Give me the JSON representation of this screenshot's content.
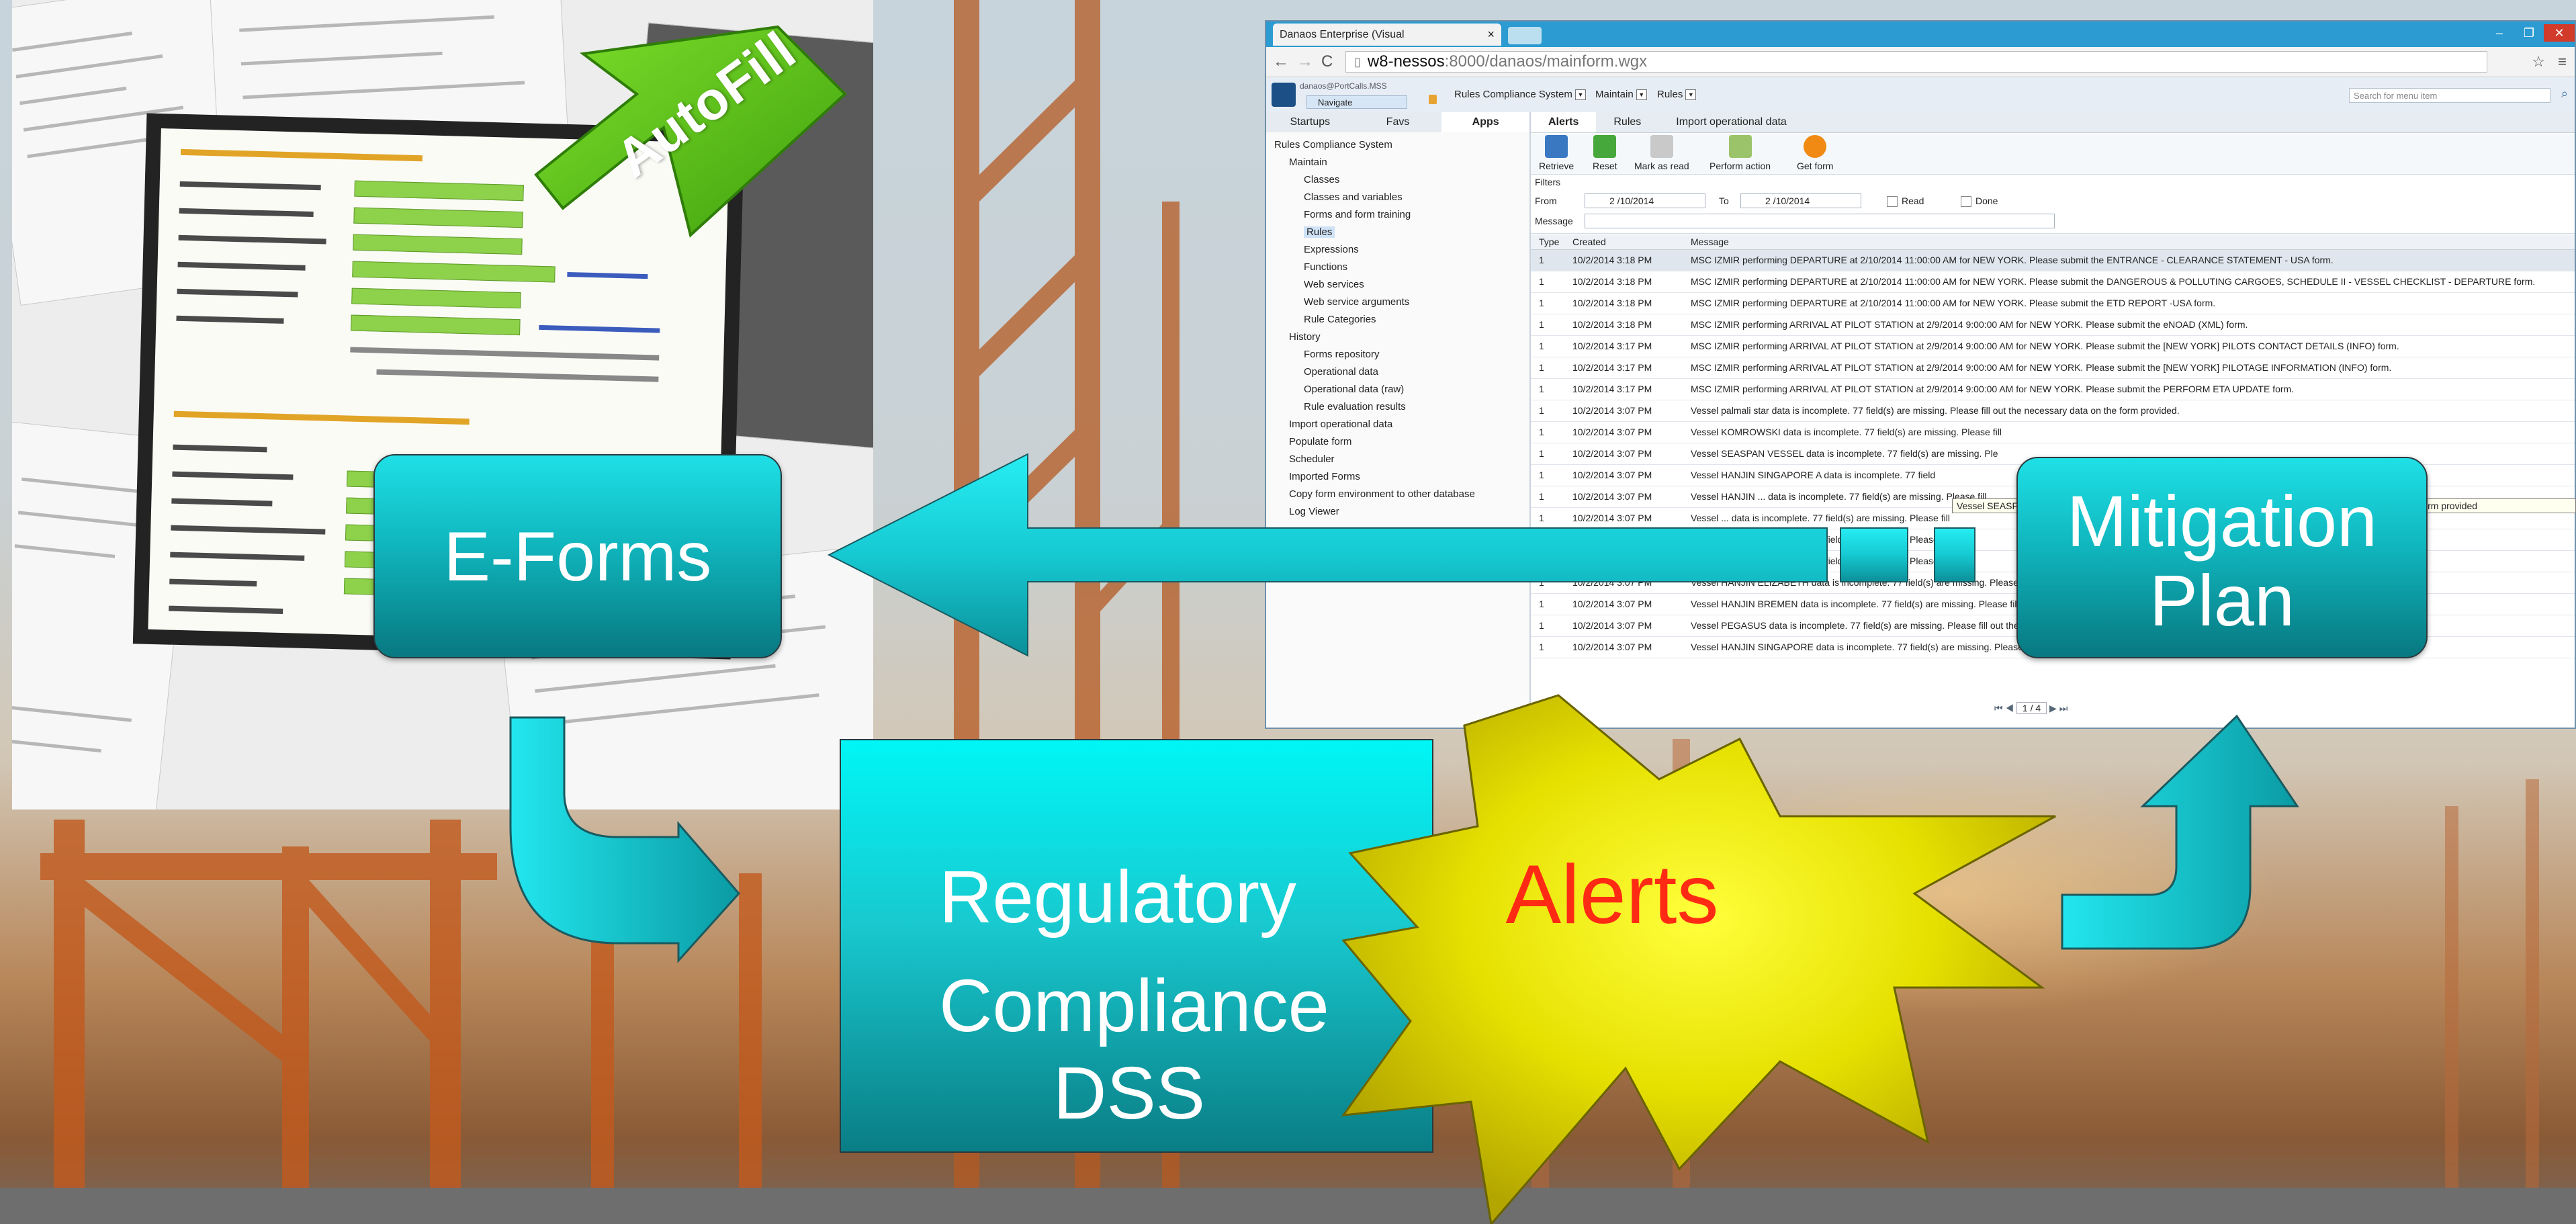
{
  "colors": {
    "box_cyan": "#12c3c9",
    "arrow_cyan": "#18d6e0",
    "alerts_yellow": "#f4f000",
    "alerts_text": "#ff2a14",
    "autofill_green": "#5ecb17"
  },
  "collage": {
    "autofill_label": "AutoFill"
  },
  "browser": {
    "tab_title": "Danaos Enterprise (Visual",
    "url_host": "w8-nessos",
    "url_path": ":8000/danaos/mainform.wgx",
    "user": "danaos@PortCalls.MSS",
    "navigate": "Navigate",
    "breadcrumbs": [
      "Rules Compliance System",
      "Maintain",
      "Rules"
    ],
    "search_placeholder": "Search for menu item",
    "side_tabs": [
      "Startups",
      "Favs",
      "Apps"
    ],
    "tree": [
      {
        "label": "Rules Compliance System",
        "level": 0
      },
      {
        "label": "Maintain",
        "level": 1
      },
      {
        "label": "Classes",
        "level": 2
      },
      {
        "label": "Classes and variables",
        "level": 2
      },
      {
        "label": "Forms and form training",
        "level": 2
      },
      {
        "label": "Rules",
        "level": 2
      },
      {
        "label": "Expressions",
        "level": 2
      },
      {
        "label": "Functions",
        "level": 2
      },
      {
        "label": "Web services",
        "level": 2
      },
      {
        "label": "Web service arguments",
        "level": 2
      },
      {
        "label": "Rule Categories",
        "level": 2
      },
      {
        "label": "History",
        "level": 1
      },
      {
        "label": "Forms repository",
        "level": 2
      },
      {
        "label": "Operational data",
        "level": 2
      },
      {
        "label": "Operational data (raw)",
        "level": 2
      },
      {
        "label": "Rule evaluation results",
        "level": 2
      },
      {
        "label": "Import operational data",
        "level": 1
      },
      {
        "label": "Populate form",
        "level": 1
      },
      {
        "label": "Scheduler",
        "level": 1
      },
      {
        "label": "Imported Forms",
        "level": 1
      },
      {
        "label": "Copy form environment to other database",
        "level": 1
      },
      {
        "label": "Log Viewer",
        "level": 1
      }
    ],
    "main_tabs": [
      "Alerts",
      "Rules",
      "Import operational data"
    ],
    "actions": [
      "Retrieve",
      "Reset",
      "Mark as read",
      "Perform action",
      "Get form"
    ],
    "filters": {
      "title": "Filters",
      "from_label": "From",
      "from_date": "2 /10/2014",
      "to_label": "To",
      "to_date": "2 /10/2014",
      "read_label": "Read",
      "done_label": "Done",
      "message_label": "Message"
    },
    "columns": [
      "Type",
      "Created",
      "Message"
    ],
    "rows": [
      {
        "type": "1",
        "created": "10/2/2014 3:18 PM",
        "message": "MSC IZMIR performing DEPARTURE at 2/10/2014 11:00:00 AM for NEW YORK. Please submit the ENTRANCE - CLEARANCE STATEMENT - USA form."
      },
      {
        "type": "1",
        "created": "10/2/2014 3:18 PM",
        "message": "MSC IZMIR performing DEPARTURE at 2/10/2014 11:00:00 AM for NEW YORK. Please submit the DANGEROUS & POLLUTING CARGOES, SCHEDULE II - VESSEL CHECKLIST - DEPARTURE form."
      },
      {
        "type": "1",
        "created": "10/2/2014 3:18 PM",
        "message": "MSC IZMIR performing DEPARTURE at 2/10/2014 11:00:00 AM for NEW YORK. Please submit the ETD REPORT -USA form."
      },
      {
        "type": "1",
        "created": "10/2/2014 3:18 PM",
        "message": "MSC IZMIR performing ARRIVAL AT PILOT STATION at 2/9/2014 9:00:00 AM for NEW YORK. Please submit the eNOAD (XML) form."
      },
      {
        "type": "1",
        "created": "10/2/2014 3:17 PM",
        "message": "MSC IZMIR performing ARRIVAL AT PILOT STATION at 2/9/2014 9:00:00 AM for NEW YORK. Please submit the [NEW YORK] PILOTS CONTACT DETAILS (INFO) form."
      },
      {
        "type": "1",
        "created": "10/2/2014 3:17 PM",
        "message": "MSC IZMIR performing ARRIVAL AT PILOT STATION at 2/9/2014 9:00:00 AM for NEW YORK. Please submit the [NEW YORK] PILOTAGE INFORMATION (INFO) form."
      },
      {
        "type": "1",
        "created": "10/2/2014 3:17 PM",
        "message": "MSC IZMIR performing ARRIVAL AT PILOT STATION at 2/9/2014 9:00:00 AM for NEW YORK. Please submit the PERFORM ETA UPDATE form."
      },
      {
        "type": "1",
        "created": "10/2/2014 3:07 PM",
        "message": "Vessel palmali star data is incomplete. 77 field(s) are missing. Please fill out the necessary data on the form provided."
      },
      {
        "type": "1",
        "created": "10/2/2014 3:07 PM",
        "message": "Vessel KOMROWSKI data is incomplete. 77 field(s) are missing. Please fill"
      },
      {
        "type": "1",
        "created": "10/2/2014 3:07 PM",
        "message": "Vessel SEASPAN VESSEL data is incomplete. 77 field(s) are missing. Ple"
      },
      {
        "type": "1",
        "created": "10/2/2014 3:07 PM",
        "message": "Vessel HANJIN SINGAPORE A data is incomplete. 77 field"
      },
      {
        "type": "1",
        "created": "10/2/2014 3:07 PM",
        "message": "Vessel HANJIN ... data is incomplete. 77 field(s) are missing. Please fill"
      },
      {
        "type": "1",
        "created": "10/2/2014 3:07 PM",
        "message": "Vessel ... data is incomplete. 77 field(s) are missing. Please fill"
      },
      {
        "type": "1",
        "created": "10/2/2014 3:07 PM",
        "message": "Vessel ... data is incomplete. 77 field(s) are missing. Please"
      },
      {
        "type": "1",
        "created": "10/2/2014 3:07 PM",
        "message": "Vessel ... data is incomplete. 77 field(s) are missing. Please"
      },
      {
        "type": "1",
        "created": "10/2/2014 3:07 PM",
        "message": "Vessel HANJIN ELIZABETH data is incomplete. 77 field(s) are missing. Please fill"
      },
      {
        "type": "1",
        "created": "10/2/2014 3:07 PM",
        "message": "Vessel HANJIN BREMEN data is incomplete. 77 field(s) are missing. Please fill"
      },
      {
        "type": "1",
        "created": "10/2/2014 3:07 PM",
        "message": "Vessel PEGASUS data is incomplete. 77 field(s) are missing. Please fill out the necessary data on the form provided."
      },
      {
        "type": "1",
        "created": "10/2/2014 3:07 PM",
        "message": "Vessel HANJIN SINGAPORE data is incomplete. 77 field(s) are missing. Please fill out the necessary data on the form provided."
      }
    ],
    "tooltip": "Vessel SEASPAN VESSEL data is incomplete. 77 field(s) are missing. Please fill out the necessary data on the form provided",
    "pager": "1 / 4"
  },
  "diagram": {
    "eforms": "E-Forms",
    "mitigation_line1": "Mitigation",
    "mitigation_line2": "Plan",
    "dss_line1": "Regulatory",
    "dss_line2": "Compliance",
    "dss_line3": "DSS",
    "alerts": "Alerts"
  }
}
